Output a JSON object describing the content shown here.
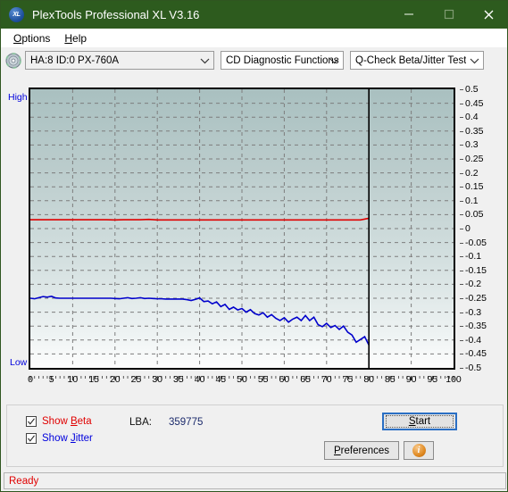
{
  "window": {
    "title": "PlexTools Professional XL V3.16",
    "app_icon": "XL",
    "minimize_label": "minimize",
    "maximize_label": "maximize",
    "close_label": "close"
  },
  "menubar": {
    "items": [
      {
        "label": "Options",
        "mnemonic": "O"
      },
      {
        "label": "Help",
        "mnemonic": "H"
      }
    ]
  },
  "toolbar": {
    "drive_select": "HA:8 ID:0  PX-760A",
    "function_select": "CD Diagnostic Functions",
    "test_select": "Q-Check Beta/Jitter Test",
    "arrow": "⌄"
  },
  "chart_panel": {
    "high_label": "High",
    "low_label": "Low"
  },
  "controls": {
    "show_beta_label": "Show Beta",
    "show_beta_mnemonic": "B",
    "show_beta_checked": true,
    "show_jitter_label": "Show Jitter",
    "show_jitter_mnemonic": "J",
    "show_jitter_checked": true,
    "lba_label": "LBA:",
    "lba_value": "359775",
    "start_label": "Start",
    "start_mnemonic": "S",
    "preferences_label": "Preferences",
    "preferences_mnemonic": "P",
    "info_label": "i"
  },
  "statusbar": {
    "text": "Ready"
  },
  "colors": {
    "titlebar": "#2d5b1e",
    "beta_line": "#e00000",
    "jitter_line": "#0000cc",
    "accent_blue": "#0000dd",
    "status_red": "#e00000",
    "panel_bg": "#f0f0f0"
  },
  "chart_data": {
    "type": "line",
    "title": "Q-Check Beta/Jitter Test",
    "xlabel": "",
    "ylabel": "",
    "xlim": [
      0,
      100
    ],
    "ylim": [
      -0.5,
      0.5
    ],
    "xticks": [
      0,
      5,
      10,
      15,
      20,
      25,
      30,
      35,
      40,
      45,
      50,
      55,
      60,
      65,
      70,
      75,
      80,
      85,
      90,
      95,
      100
    ],
    "yticks": [
      0.5,
      0.45,
      0.4,
      0.35,
      0.3,
      0.25,
      0.2,
      0.15,
      0.1,
      0.05,
      0,
      -0.05,
      -0.1,
      -0.15,
      -0.2,
      -0.25,
      -0.3,
      -0.35,
      -0.4,
      -0.45,
      -0.5
    ],
    "grid": true,
    "legend": [
      "Show Beta",
      "Show Jitter"
    ],
    "legend_position": "bottom-left",
    "annotations": [
      {
        "type": "vline",
        "x": 80,
        "color": "#000000",
        "note": "end-of-data marker"
      },
      {
        "type": "axis-label",
        "text": "High",
        "position": "top-left"
      },
      {
        "type": "axis-label",
        "text": "Low",
        "position": "bottom-left"
      }
    ],
    "series": [
      {
        "name": "Beta",
        "color": "#e00000",
        "x": [
          0,
          2,
          4,
          6,
          8,
          10,
          12,
          14,
          16,
          18,
          20,
          22,
          24,
          26,
          28,
          30,
          32,
          34,
          36,
          38,
          40,
          42,
          44,
          46,
          48,
          50,
          52,
          54,
          56,
          58,
          60,
          62,
          64,
          66,
          68,
          70,
          72,
          74,
          76,
          78,
          80
        ],
        "values": [
          0.032,
          0.032,
          0.032,
          0.032,
          0.032,
          0.032,
          0.032,
          0.032,
          0.032,
          0.032,
          0.031,
          0.032,
          0.032,
          0.032,
          0.033,
          0.031,
          0.031,
          0.031,
          0.031,
          0.031,
          0.031,
          0.031,
          0.031,
          0.031,
          0.031,
          0.031,
          0.031,
          0.031,
          0.031,
          0.031,
          0.031,
          0.031,
          0.031,
          0.031,
          0.031,
          0.031,
          0.031,
          0.031,
          0.031,
          0.031,
          0.037
        ]
      },
      {
        "name": "Jitter",
        "color": "#0000cc",
        "x": [
          0,
          1,
          2,
          3,
          4,
          5,
          6,
          7,
          8,
          9,
          10,
          11,
          12,
          13,
          14,
          15,
          16,
          17,
          18,
          19,
          20,
          21,
          22,
          23,
          24,
          25,
          26,
          27,
          28,
          29,
          30,
          31,
          32,
          33,
          34,
          35,
          36,
          37,
          38,
          39,
          40,
          41,
          42,
          43,
          44,
          45,
          46,
          47,
          48,
          49,
          50,
          51,
          52,
          53,
          54,
          55,
          56,
          57,
          58,
          59,
          60,
          61,
          62,
          63,
          64,
          65,
          66,
          67,
          68,
          69,
          70,
          71,
          72,
          73,
          74,
          75,
          76,
          77,
          78,
          79,
          80
        ],
        "values": [
          -0.25,
          -0.252,
          -0.248,
          -0.244,
          -0.246,
          -0.243,
          -0.249,
          -0.25,
          -0.25,
          -0.25,
          -0.25,
          -0.25,
          -0.25,
          -0.25,
          -0.25,
          -0.25,
          -0.25,
          -0.25,
          -0.25,
          -0.25,
          -0.251,
          -0.252,
          -0.25,
          -0.248,
          -0.251,
          -0.25,
          -0.248,
          -0.251,
          -0.25,
          -0.251,
          -0.252,
          -0.252,
          -0.253,
          -0.253,
          -0.253,
          -0.253,
          -0.253,
          -0.255,
          -0.258,
          -0.254,
          -0.249,
          -0.262,
          -0.26,
          -0.27,
          -0.263,
          -0.28,
          -0.272,
          -0.29,
          -0.282,
          -0.292,
          -0.287,
          -0.3,
          -0.291,
          -0.305,
          -0.31,
          -0.302,
          -0.318,
          -0.309,
          -0.322,
          -0.33,
          -0.32,
          -0.336,
          -0.325,
          -0.318,
          -0.33,
          -0.312,
          -0.33,
          -0.318,
          -0.345,
          -0.352,
          -0.34,
          -0.355,
          -0.348,
          -0.362,
          -0.35,
          -0.372,
          -0.382,
          -0.408,
          -0.398,
          -0.388,
          -0.418
        ]
      }
    ]
  }
}
